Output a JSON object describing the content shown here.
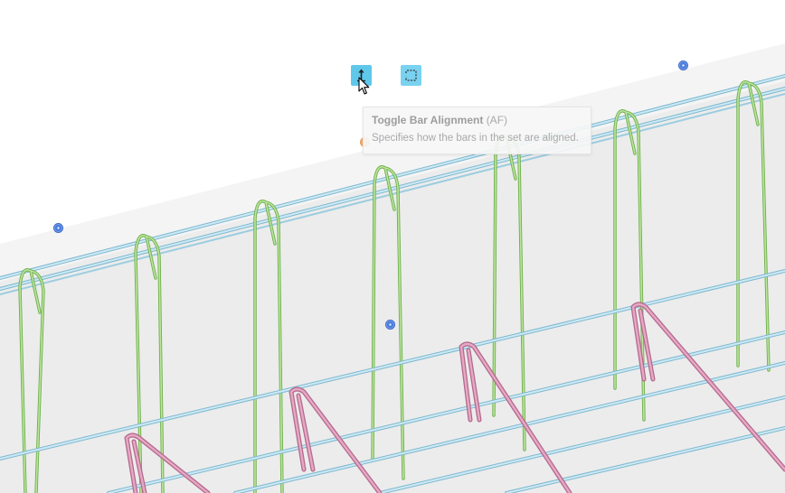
{
  "tooltip": {
    "title": "Toggle Bar Alignment",
    "shortcut": "(AF)",
    "description": "Specifies how the bars in the set are aligned."
  },
  "toolbar": {
    "buttons": [
      {
        "icon": "bar-alignment-icon"
      },
      {
        "icon": "bar-shape-icon"
      }
    ]
  },
  "colors": {
    "accent": "#5fc8ea",
    "stirrup": "#8fd36a",
    "longitudinal": "#9fd4ea",
    "bottom_bar": "#d98bb0",
    "grip": "#4a7de0",
    "grip_active": "#f2b070"
  }
}
